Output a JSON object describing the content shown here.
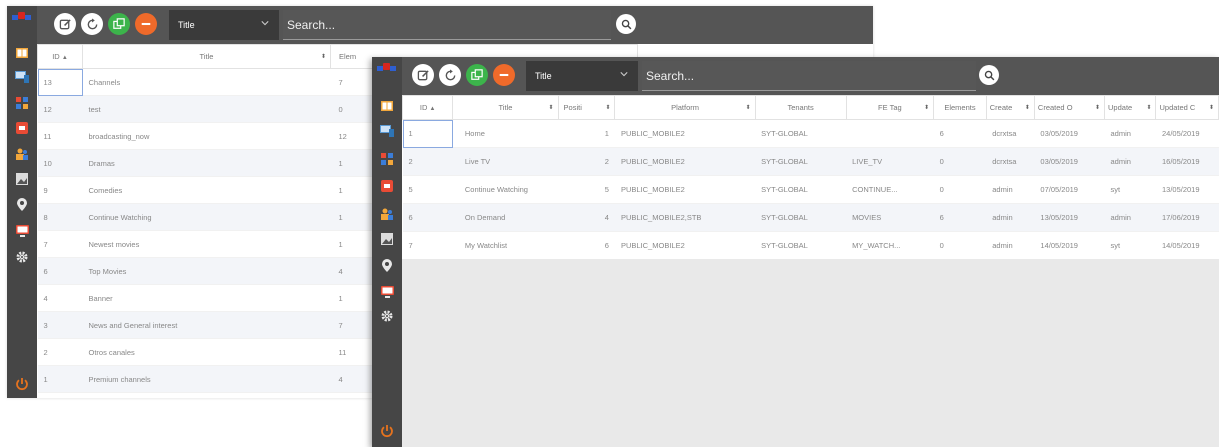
{
  "search_placeholder": "Search...",
  "field_select_value": "Title",
  "colors": {
    "sidebar": "#464646",
    "topbar": "#555555",
    "add": "#3cb44b",
    "delete": "#ef6a2a"
  },
  "sidebar_icons": [
    "catalog-icon",
    "devices-icon",
    "categories-icon",
    "media-icon",
    "users-icon",
    "images-icon",
    "location-icon",
    "monitor-icon",
    "settings-icon"
  ],
  "back": {
    "columns": {
      "id": "ID",
      "title": "Title",
      "elements": "Elem"
    },
    "rows": [
      {
        "id": "13",
        "title": "Channels",
        "elements": "7"
      },
      {
        "id": "12",
        "title": "test",
        "elements": "0"
      },
      {
        "id": "11",
        "title": "broadcasting_now",
        "elements": "12"
      },
      {
        "id": "10",
        "title": "Dramas",
        "elements": "1"
      },
      {
        "id": "9",
        "title": "Comedies",
        "elements": "1"
      },
      {
        "id": "8",
        "title": "Continue Watching",
        "elements": "1"
      },
      {
        "id": "7",
        "title": "Newest movies",
        "elements": "1"
      },
      {
        "id": "6",
        "title": "Top Movies",
        "elements": "4"
      },
      {
        "id": "4",
        "title": "Banner",
        "elements": "1"
      },
      {
        "id": "3",
        "title": "News and General interest",
        "elements": "7"
      },
      {
        "id": "2",
        "title": "Otros canales",
        "elements": "11"
      },
      {
        "id": "1",
        "title": "Premium channels",
        "elements": "4"
      }
    ]
  },
  "front": {
    "columns": {
      "id": "ID",
      "title": "Title",
      "position": "Positi",
      "platform": "Platform",
      "tenants": "Tenants",
      "fe_tag": "FE Tag",
      "elements": "Elements",
      "created_by": "Create",
      "created_on": "Created O",
      "updated_by": "Update",
      "updated_on": "Updated C"
    },
    "rows": [
      {
        "id": "1",
        "title": "Home",
        "position": "1",
        "platform": "PUBLIC_MOBILE2",
        "tenants": "SYT-GLOBAL",
        "fe_tag": "",
        "elements": "6",
        "created_by": "dcrxtsa",
        "created_on": "03/05/2019",
        "updated_by": "admin",
        "updated_on": "24/05/2019"
      },
      {
        "id": "2",
        "title": "Live TV",
        "position": "2",
        "platform": "PUBLIC_MOBILE2",
        "tenants": "SYT-GLOBAL",
        "fe_tag": "LIVE_TV",
        "elements": "0",
        "created_by": "dcrxtsa",
        "created_on": "03/05/2019",
        "updated_by": "admin",
        "updated_on": "16/05/2019"
      },
      {
        "id": "5",
        "title": "Continue Watching",
        "position": "5",
        "platform": "PUBLIC_MOBILE2",
        "tenants": "SYT-GLOBAL",
        "fe_tag": "CONTINUE...",
        "elements": "0",
        "created_by": "admin",
        "created_on": "07/05/2019",
        "updated_by": "syt",
        "updated_on": "13/05/2019"
      },
      {
        "id": "6",
        "title": "On Demand",
        "position": "4",
        "platform": "PUBLIC_MOBILE2,STB",
        "tenants": "SYT-GLOBAL",
        "fe_tag": "MOVIES",
        "elements": "6",
        "created_by": "admin",
        "created_on": "13/05/2019",
        "updated_by": "admin",
        "updated_on": "17/06/2019"
      },
      {
        "id": "7",
        "title": "My Watchlist",
        "position": "6",
        "platform": "PUBLIC_MOBILE2",
        "tenants": "SYT-GLOBAL",
        "fe_tag": "MY_WATCH...",
        "elements": "0",
        "created_by": "admin",
        "created_on": "14/05/2019",
        "updated_by": "syt",
        "updated_on": "14/05/2019"
      }
    ]
  }
}
